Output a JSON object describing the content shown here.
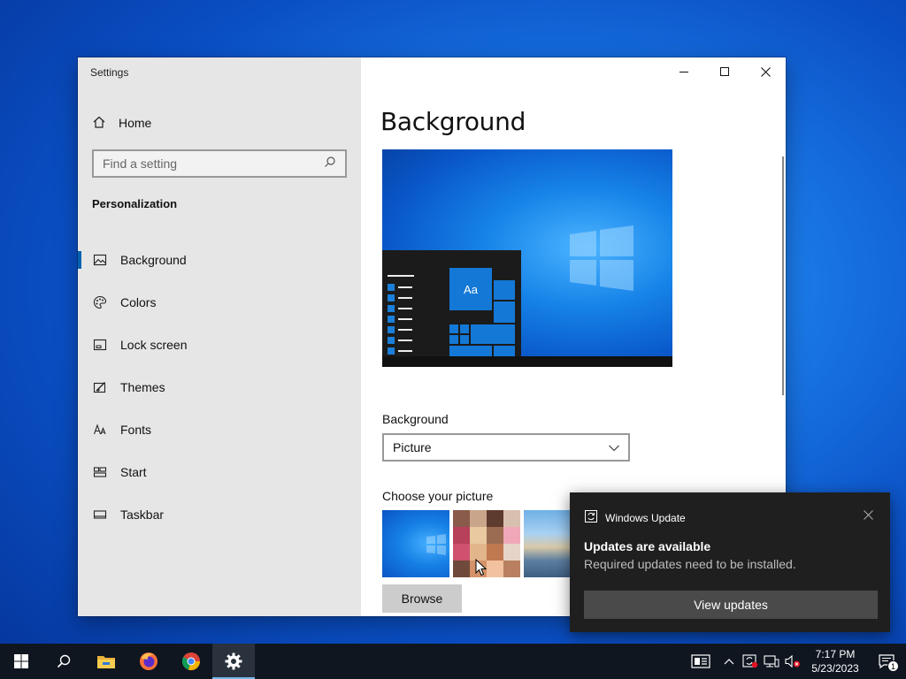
{
  "window": {
    "title": "Settings",
    "controls": {
      "minimize": "minimize",
      "maximize": "maximize",
      "close": "close"
    }
  },
  "sidebar": {
    "home_label": "Home",
    "search_placeholder": "Find a setting",
    "section_title": "Personalization",
    "items": [
      {
        "label": "Background",
        "icon": "picture-icon",
        "active": true
      },
      {
        "label": "Colors",
        "icon": "palette-icon",
        "active": false
      },
      {
        "label": "Lock screen",
        "icon": "lock-screen-icon",
        "active": false
      },
      {
        "label": "Themes",
        "icon": "themes-icon",
        "active": false
      },
      {
        "label": "Fonts",
        "icon": "fonts-icon",
        "active": false
      },
      {
        "label": "Start",
        "icon": "start-icon",
        "active": false
      },
      {
        "label": "Taskbar",
        "icon": "taskbar-icon",
        "active": false
      }
    ]
  },
  "main": {
    "title": "Background",
    "preview_tile_text": "Aa",
    "background_label": "Background",
    "background_value": "Picture",
    "choose_label": "Choose your picture",
    "browse_label": "Browse"
  },
  "toast": {
    "app_name": "Windows Update",
    "title": "Updates are available",
    "body": "Required updates need to be installed.",
    "button_label": "View updates"
  },
  "taskbar": {
    "apps": [
      "start-icon",
      "search-icon",
      "file-explorer-icon",
      "firefox-icon",
      "chrome-icon",
      "settings-icon"
    ],
    "time": "7:17 PM",
    "date": "5/23/2023",
    "notification_count": "1"
  },
  "colors": {
    "accent": "#0063b1",
    "toast_bg": "#1f1f1f",
    "taskbar_bg": "#0f1620"
  }
}
